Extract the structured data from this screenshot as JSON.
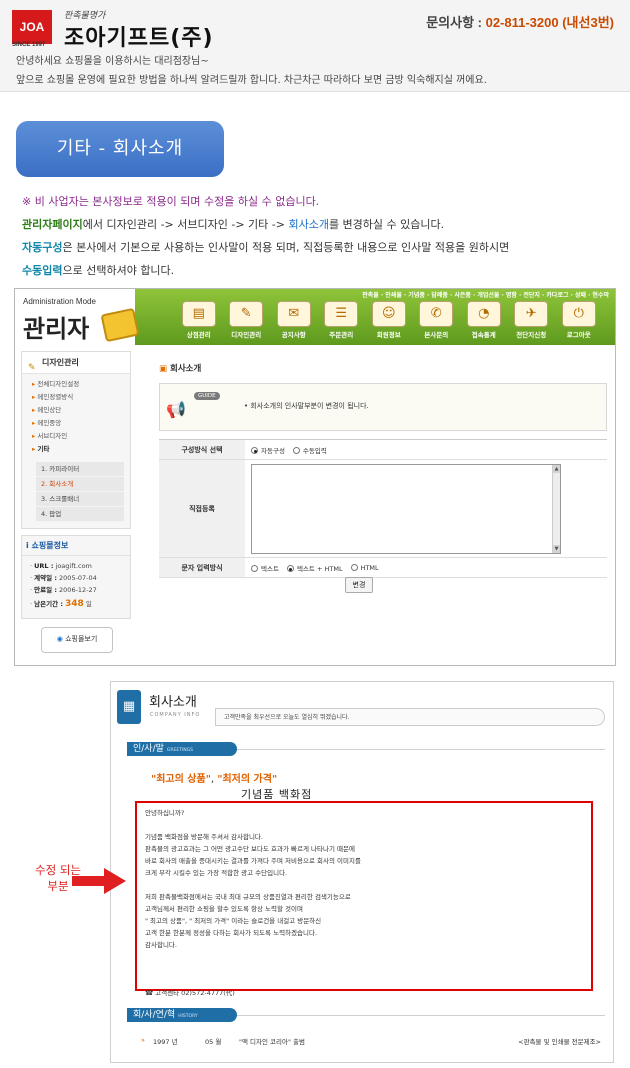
{
  "header": {
    "logo_abbr": "JOA",
    "logo_since": "SINCE 1997",
    "logo_tagline": "판촉물명가",
    "logo_name": "조아기프트(주)",
    "contact_label": "문의사항 : ",
    "contact_number": "02-811-3200 (내선3번)",
    "greeting_line1": "안녕하세요 쇼핑몰을 이용하시는 대리점장님~",
    "greeting_line2": "앞으로 쇼핑몰 운영에 필요한 방법을 하나씩 알려드릴까 합니다. 차근차근 따라하다 보면 금방 익숙해지실 꺼에요."
  },
  "banner": {
    "title": "기타 - 회사소개"
  },
  "notes": {
    "line1": "※ 비 사업자는 본사정보로 적용이 되며 수정을 하실 수 없습니다.",
    "line2_a": "관리자페이지",
    "line2_b": "에서 디자인관리 -> 서브디자인 -> 기타 -> ",
    "line2_c": "회사소개",
    "line2_d": "를 변경하실 수 있습니다.",
    "line3_a": "자동구성",
    "line3_b": "은 본사에서 기본으로 사용하는 인사말이 적용 되며, 직접등록한 내용으로 인사말 적용을 원하시면",
    "line4_a": "수동입력",
    "line4_b": "으로 선택하셔야 합니다."
  },
  "admin": {
    "mode_label": "Administration Mode",
    "title": "관리자",
    "top_links": "판촉물 · 인쇄물 · 기념품 · 답례품 · 사은품 · 개업선물 · 명함 · 전단지 · 카다로그 · 상패 · 현수막",
    "nav": [
      {
        "label": "상점관리",
        "icon": "store-icon",
        "glyph": "▤"
      },
      {
        "label": "디자인관리",
        "icon": "palette-icon",
        "glyph": "✎"
      },
      {
        "label": "공지사항",
        "icon": "notice-icon",
        "glyph": "✉"
      },
      {
        "label": "주문관리",
        "icon": "order-icon",
        "glyph": "☰"
      },
      {
        "label": "회원정보",
        "icon": "member-icon",
        "glyph": "☺"
      },
      {
        "label": "본사문의",
        "icon": "inquiry-icon",
        "glyph": "✆"
      },
      {
        "label": "접속통계",
        "icon": "stats-icon",
        "glyph": "◔"
      },
      {
        "label": "전단지신청",
        "icon": "flyer-icon",
        "glyph": "✈"
      },
      {
        "label": "로그아웃",
        "icon": "logout-icon",
        "glyph": "⏻"
      }
    ],
    "side_title": "디자인관리",
    "side_items": [
      "전체디자인설정",
      "메인정렬방식",
      "메인상단",
      "메인중앙",
      "서브디자인",
      "기타"
    ],
    "side_sub_items": [
      "1. 카피라이터",
      "2. 회사소개",
      "3. 스크롤배너",
      "4. 팝업"
    ],
    "info_title": "쇼핑몰정보",
    "info": {
      "url_label": "URL :",
      "url_value": "joagift.com",
      "contract_label": "계약일 :",
      "contract_value": "2005-07-04",
      "end_label": "만료일 :",
      "end_value": "2006-12-27",
      "remain_label": "남은기간 :",
      "remain_value": "348",
      "remain_unit": "일"
    },
    "mall_button": "쇼핑몰보기",
    "main_title": "회사소개",
    "guide_badge": "GUIDE",
    "guide_text": "•  회사소개의 인사말부분이 변경이 됩니다.",
    "form": {
      "row1_label": "구성방식 선택",
      "row1_opt1": "자동구성",
      "row1_opt2": "수동입력",
      "row2_label": "직접등록",
      "row3_label": "문자 입력방식",
      "row3_opt1": "텍스트",
      "row3_opt2": "텍스트 + HTML",
      "row3_opt3": "HTML"
    },
    "modify_button": "변경"
  },
  "preview": {
    "title": "회사소개",
    "title_en": "COMPANY INFO",
    "strip_text": "고객만족을 최우선으로 오늘도 열심히 뛰겠습니다.",
    "greeting_tab": "인/사/말",
    "greeting_tab_en": "GREETINGS",
    "slogan_a": "\"최고의 상품\"",
    "slogan_sep": ", ",
    "slogan_b": "\"최저의 가격\"",
    "store_name": "기념품 백화점",
    "body_lines": [
      "안녕하십니까?",
      "",
      "기념품 백화점을 방문해 주셔서 감사합니다.",
      "판촉물의 광고효과는 그 어떤 광고수단 보다도 효과가 빠르게 나타나기 때문에",
      "바로 회사의 매출을 증대시키는 결과를 가져다 주며 저비용으로 회사의 이미지를",
      "크게 부각 시킬수 있는 가장 적합한 광고 수단입니다.",
      "",
      "저희 판촉물백화점에서는 국내 최대 규모의 상품진열과 편리한 검색기능으로",
      "고객님께서 편리한 쇼핑을 할수 있도록 항상 노력할 것이며",
      "\" 최고의 상품\", \" 최저의 가격\" 이라는 슬로건을 내걸고 방문하신",
      "고객 한분 한분께 정성을 다하는 회사가 되도록 노력하겠습니다.",
      "감사합니다.",
      "",
      "",
      "",
      "☎ 고객센타 02)572-4777(代)"
    ],
    "history_tab": "회/사/연/혁",
    "history_tab_en": "HISTORY",
    "history": {
      "year": "1997 년",
      "month": "05 월",
      "event": "\"맥 디자인 코리아\" 출범",
      "note": "<판촉물 및 인쇄물 전문제조>"
    }
  },
  "callout": {
    "line1": "수정 되는",
    "line2": "부분",
    "color": "#e02020"
  }
}
